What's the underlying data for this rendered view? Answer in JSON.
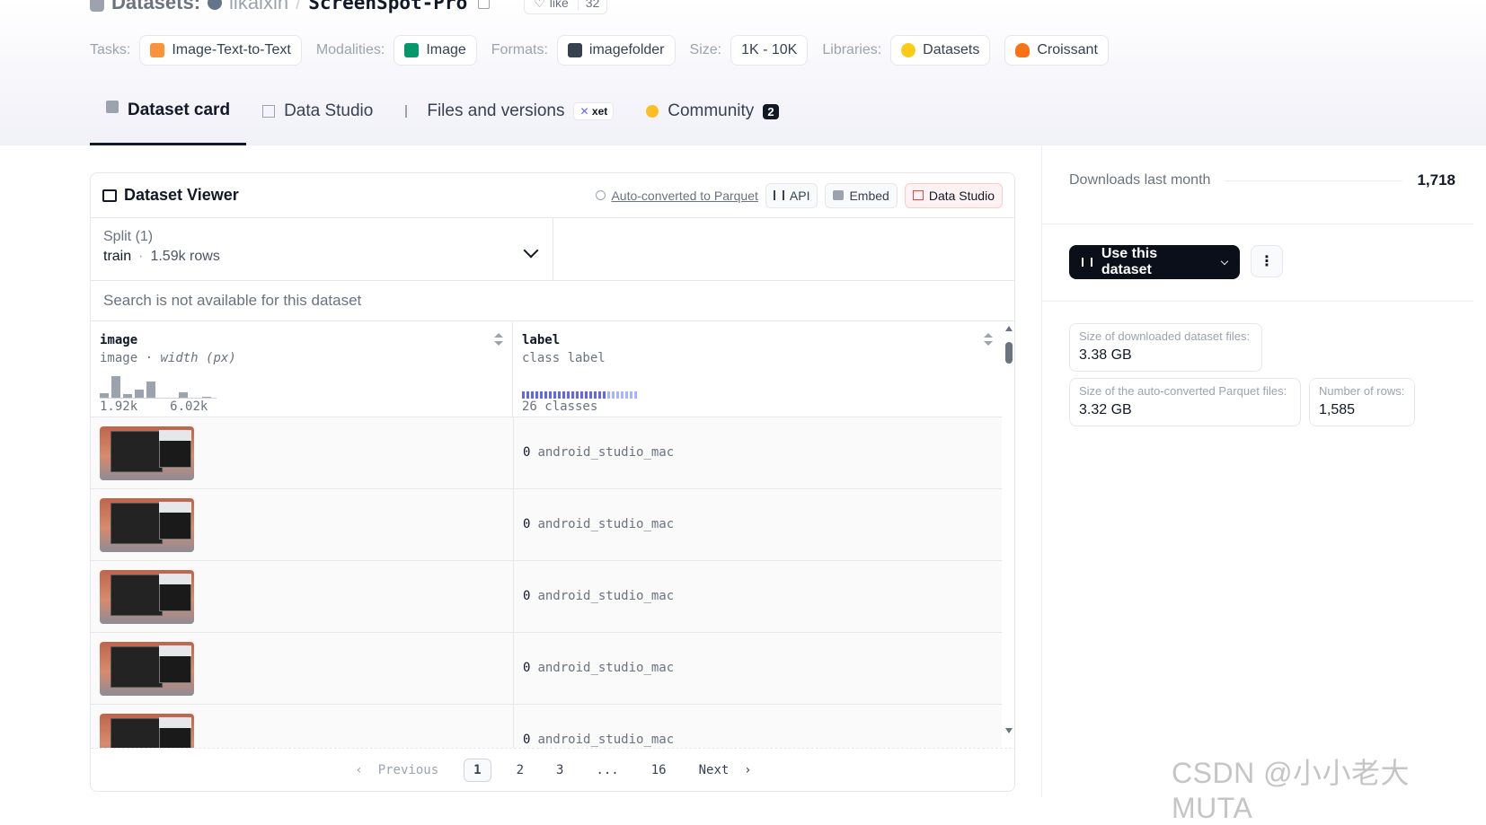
{
  "header": {
    "datasets_label": "Datasets:",
    "org": "likaixin",
    "slash": "/",
    "repo": "ScreenSpot-Pro",
    "like_label": "like",
    "like_count": "32",
    "tags": {
      "tasks_label": "Tasks:",
      "task": "Image-Text-to-Text",
      "modalities_label": "Modalities:",
      "modality": "Image",
      "formats_label": "Formats:",
      "format": "imagefolder",
      "size_label": "Size:",
      "size": "1K - 10K",
      "libraries_label": "Libraries:",
      "lib1": "Datasets",
      "lib2": "Croissant"
    },
    "tabs": [
      {
        "label": "Dataset card",
        "icon": "card-icon"
      },
      {
        "label": "Data Studio",
        "icon": "grid-icon"
      },
      {
        "label": "Files and versions",
        "icon": "files-icon",
        "badge": "xet"
      },
      {
        "label": "Community",
        "icon": "community-icon",
        "count": "2"
      }
    ]
  },
  "viewer": {
    "title": "Dataset Viewer",
    "auto_converted": "Auto-converted to Parquet",
    "api": "API",
    "embed": "Embed",
    "data_studio": "Data Studio",
    "split_label": "Split (1)",
    "split_name": "train",
    "split_dot": "·",
    "split_rows": "1.59k rows",
    "search_note": "Search is not available for this dataset",
    "columns": [
      {
        "name": "image",
        "type": "image",
        "type_sep": "·",
        "type_extra": "width (px)",
        "hist_min": "1.92k",
        "hist_max": "6.02k"
      },
      {
        "name": "label",
        "type": "class label",
        "classes": "26 classes"
      }
    ],
    "rows": [
      {
        "num": "0",
        "label": "android_studio_mac"
      },
      {
        "num": "0",
        "label": "android_studio_mac"
      },
      {
        "num": "0",
        "label": "android_studio_mac"
      },
      {
        "num": "0",
        "label": "android_studio_mac"
      },
      {
        "num": "0",
        "label": "android_studio_mac"
      }
    ],
    "pager": {
      "prev": "Previous",
      "pages": [
        "1",
        "2",
        "3",
        "...",
        "16"
      ],
      "next": "Next"
    }
  },
  "sidebar": {
    "downloads_label": "Downloads last month",
    "downloads_value": "1,718",
    "use_button": "Use this dataset",
    "more": "⋮",
    "stats": [
      {
        "label": "Size of downloaded dataset files:",
        "value": "3.38 GB"
      },
      {
        "label": "Size of the auto-converted Parquet files:",
        "value": "3.32 GB"
      },
      {
        "label": "Number of rows:",
        "value": "1,585"
      }
    ]
  },
  "watermark": "CSDN @小小老大MUTA",
  "colors": {
    "accent": "#6366f1",
    "dark_button": "#0b0f19",
    "data_studio_red": "#ef4444"
  }
}
